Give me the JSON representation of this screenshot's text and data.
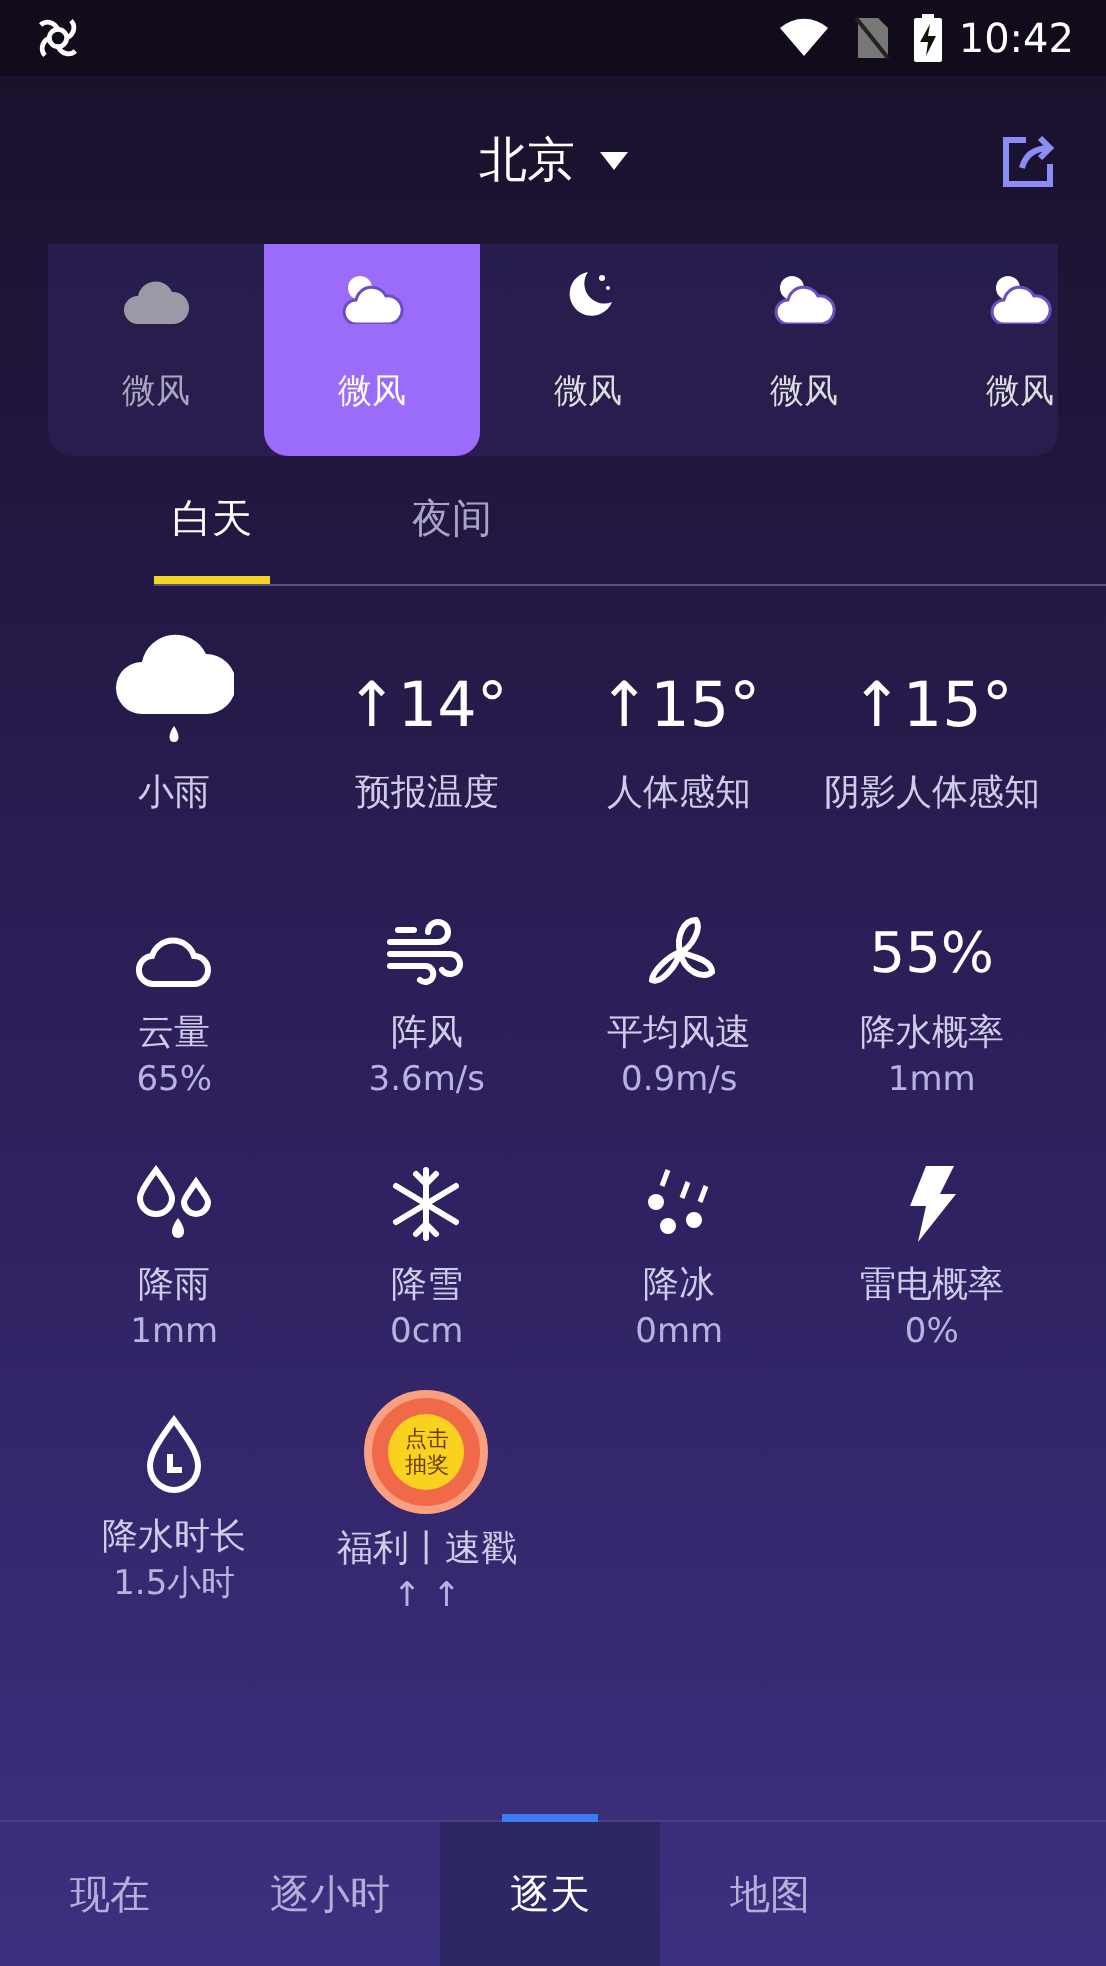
{
  "status_bar": {
    "time": "10:42"
  },
  "header": {
    "city": "北京"
  },
  "hourly": [
    {
      "kind": "cloudy",
      "label": "微风",
      "selected": false
    },
    {
      "kind": "partly",
      "label": "微风",
      "selected": true
    },
    {
      "kind": "night",
      "label": "微风",
      "selected": false
    },
    {
      "kind": "partly",
      "label": "微风",
      "selected": false
    },
    {
      "kind": "partly",
      "label": "微风",
      "selected": false
    }
  ],
  "period_tabs": [
    {
      "label": "白天",
      "selected": true
    },
    {
      "label": "夜间",
      "selected": false
    }
  ],
  "details": [
    {
      "kind": "weather",
      "label": "小雨"
    },
    {
      "kind": "temp",
      "value": "↑14°",
      "label": "预报温度"
    },
    {
      "kind": "temp",
      "value": "↑15°",
      "label": "人体感知"
    },
    {
      "kind": "temp",
      "value": "↑15°",
      "label": "阴影人体感知"
    },
    {
      "kind": "clouds",
      "label": "云量",
      "sub": "65%"
    },
    {
      "kind": "gust",
      "label": "阵风",
      "sub": "3.6m/s"
    },
    {
      "kind": "wind",
      "label": "平均风速",
      "sub": "0.9m/s"
    },
    {
      "kind": "percent",
      "value": "55",
      "unit": "%",
      "label": "降水概率",
      "sub": "1mm"
    },
    {
      "kind": "rain",
      "label": "降雨",
      "sub": "1mm"
    },
    {
      "kind": "snow",
      "label": "降雪",
      "sub": "0cm"
    },
    {
      "kind": "ice",
      "label": "降冰",
      "sub": "0mm"
    },
    {
      "kind": "thunder",
      "label": "雷电概率",
      "sub": "0%"
    },
    {
      "kind": "duration",
      "label": "降水时长",
      "sub": "1.5小时"
    },
    {
      "kind": "badge",
      "badge": "点击抽奖",
      "label": "福利丨速戳",
      "sub": "↑ ↑"
    }
  ],
  "bottom_nav": [
    {
      "label": "现在",
      "selected": false
    },
    {
      "label": "逐小时",
      "selected": false
    },
    {
      "label": "逐天",
      "selected": true
    },
    {
      "label": "地图",
      "selected": false
    }
  ]
}
